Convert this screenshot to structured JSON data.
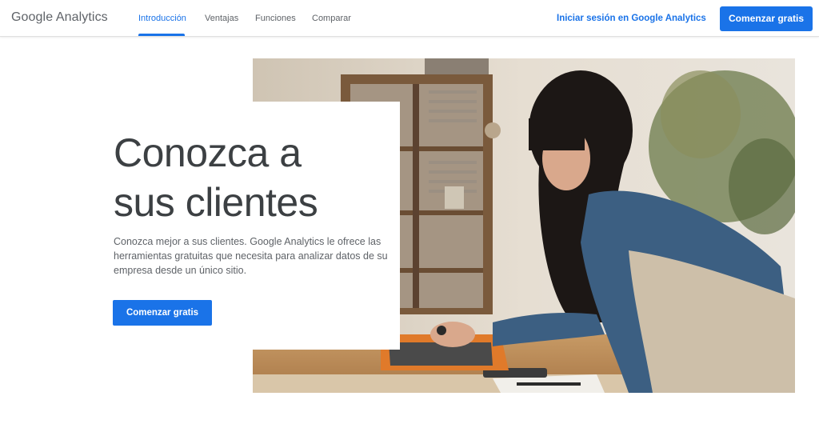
{
  "header": {
    "logo": "Google Analytics",
    "nav": [
      {
        "label": "Introducción",
        "active": true
      },
      {
        "label": "Ventajas",
        "active": false
      },
      {
        "label": "Funciones",
        "active": false
      },
      {
        "label": "Comparar",
        "active": false
      }
    ],
    "signin_label": "Iniciar sesión en Google Analytics",
    "cta_label": "Comenzar gratis"
  },
  "hero": {
    "headline_line1": "Conozca a",
    "headline_line2": "sus clientes",
    "subtext": "Conozca mejor a sus clientes. Google Analytics le ofrece las herramientas gratuitas que necesita para analizar datos de su empresa desde un único sitio.",
    "cta_label": "Comenzar gratis"
  },
  "colors": {
    "accent": "#1a73e8",
    "headline": "#3c4043",
    "body_text": "#5f6368"
  }
}
